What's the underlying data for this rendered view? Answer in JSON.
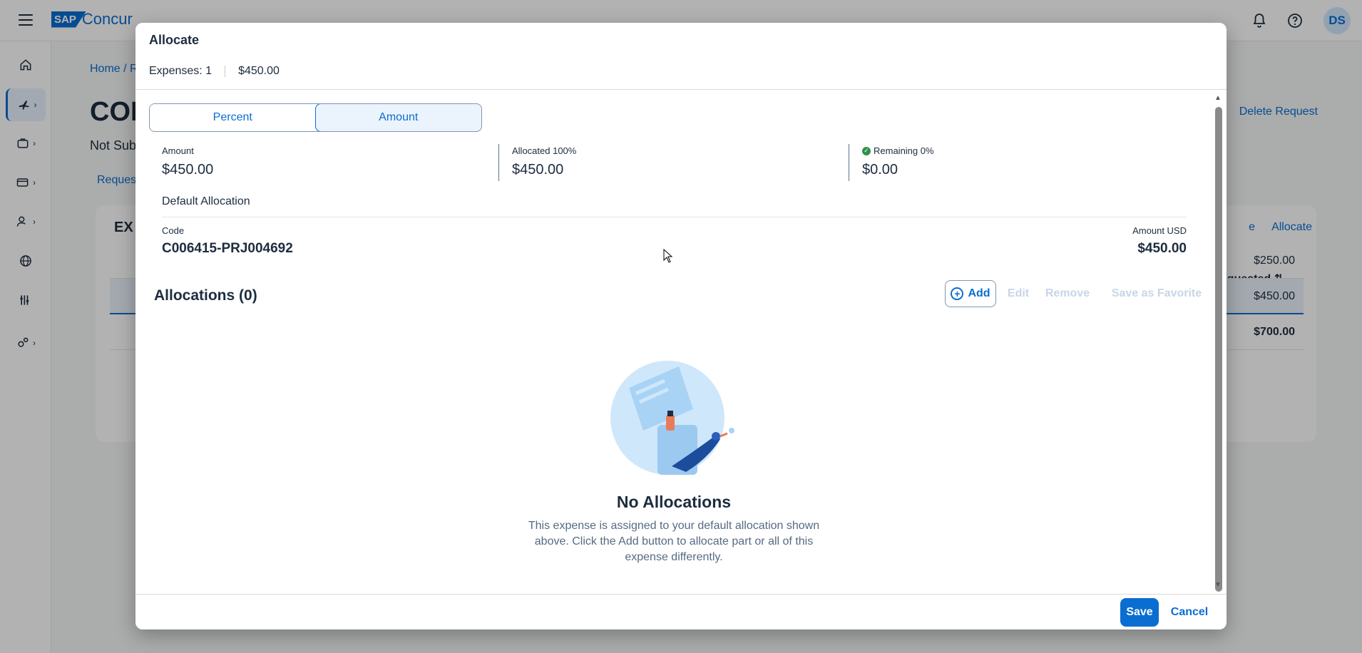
{
  "app": {
    "brand_sap": "SAP",
    "brand_name": "Concur",
    "user_initials": "DS"
  },
  "background": {
    "breadcrumb": "Home / R",
    "title": "CON",
    "status": "Not Sub",
    "tab": "Request",
    "delete_request": "Delete Request",
    "expenses_heading": "EX",
    "edit_link_fragment": "e",
    "allocate_link": "Allocate",
    "requested_header": "Requested",
    "rows": [
      {
        "amount": "$250.00"
      },
      {
        "amount": "$450.00"
      }
    ],
    "total": "$700.00"
  },
  "dialog": {
    "title": "Allocate",
    "expenses_count": "Expenses: 1",
    "expenses_amount": "$450.00",
    "segment": {
      "percent": "Percent",
      "amount": "Amount",
      "selected": "Amount"
    },
    "stats": {
      "amount_label": "Amount",
      "amount_value": "$450.00",
      "allocated_label": "Allocated 100%",
      "allocated_value": "$450.00",
      "remaining_label": "Remaining 0%",
      "remaining_value": "$0.00"
    },
    "default_allocation": {
      "heading": "Default Allocation",
      "code_label": "Code",
      "code_value": "C006415-PRJ004692",
      "amount_label": "Amount USD",
      "amount_value": "$450.00"
    },
    "allocations": {
      "title": "Allocations (0)",
      "add": "Add",
      "edit": "Edit",
      "remove": "Remove",
      "save_favorite": "Save as Favorite"
    },
    "empty": {
      "title": "No Allocations",
      "description": "This expense is assigned to your default allocation shown above. Click the Add button to allocate part or all of this expense differently."
    },
    "footer": {
      "save": "Save",
      "cancel": "Cancel"
    }
  },
  "colors": {
    "accent": "#0a6ed1",
    "success": "#30914c",
    "text": "#1d2d3e"
  }
}
